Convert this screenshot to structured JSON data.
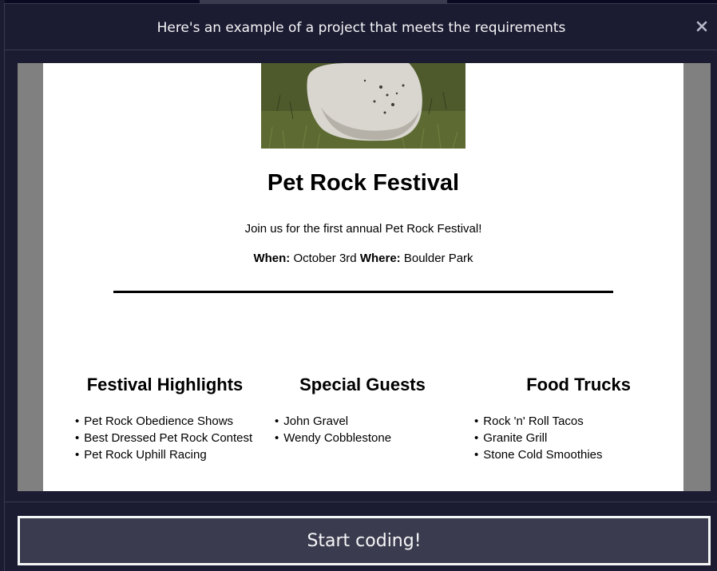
{
  "modal": {
    "title": "Here's an example of a project that meets the requirements",
    "close_icon": "close-icon"
  },
  "preview": {
    "image_icon": "rock-photo",
    "title": "Pet Rock Festival",
    "intro": "Join us for the first annual Pet Rock Festival!",
    "when_label": "When:",
    "when_value": "October 3rd",
    "where_label": "Where:",
    "where_value": "Boulder Park",
    "columns": [
      {
        "heading": "Festival Highlights",
        "items": [
          "Pet Rock Obedience Shows",
          "Best Dressed Pet Rock Contest",
          "Pet Rock Uphill Racing"
        ]
      },
      {
        "heading": "Special Guests",
        "items": [
          "John Gravel",
          "Wendy Cobblestone"
        ]
      },
      {
        "heading": "Food Trucks",
        "items": [
          "Rock 'n' Roll Tacos",
          "Granite Grill",
          "Stone Cold Smoothies"
        ]
      }
    ]
  },
  "footer": {
    "start_label": "Start coding!"
  },
  "colors": {
    "modal_bg": "#1b1b32",
    "page_bg": "#0a0a23",
    "button_bg": "#3b3b4f",
    "text_light": "#f5f6f7"
  }
}
